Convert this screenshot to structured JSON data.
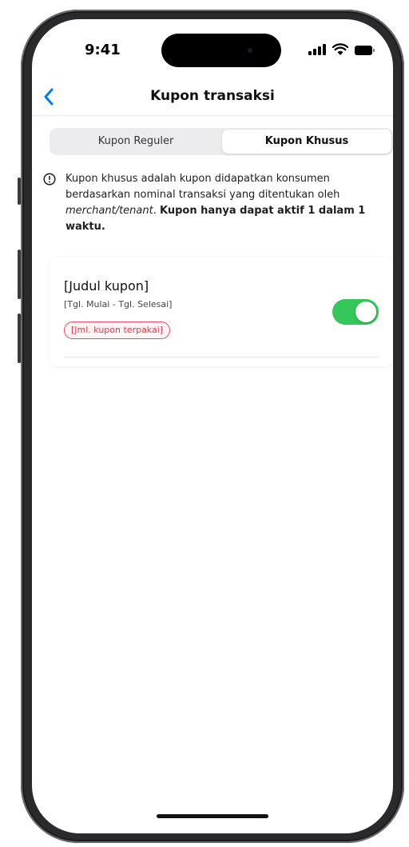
{
  "status_bar": {
    "time": "9:41",
    "icons": [
      "signal-icon",
      "wifi-icon",
      "battery-icon"
    ]
  },
  "nav": {
    "back_icon": "chevron-left-icon",
    "title": "Kupon transaksi"
  },
  "tabs": [
    {
      "label": "Kupon Reguler",
      "selected": false
    },
    {
      "label": "Kupon Khusus",
      "selected": true
    }
  ],
  "info": {
    "icon": "exclamation-circle-icon",
    "text_part1": "Kupon khusus adalah kupon didapatkan konsumen berdasarkan nominal transaksi yang ditentukan oleh ",
    "text_italic": "merchant/tenant",
    "text_part2": ". ",
    "text_bold": "Kupon hanya dapat aktif 1 dalam 1 waktu."
  },
  "coupons": [
    {
      "title": "[Judul kupon]",
      "dates": "[Tgl. Mulai - Tgl. Selesai]",
      "usage_badge": "[Jml. kupon terpakai]",
      "active": true
    }
  ],
  "colors": {
    "accent_blue": "#007aff",
    "toggle_on": "#34c759",
    "badge_red": "#e13b4b"
  }
}
